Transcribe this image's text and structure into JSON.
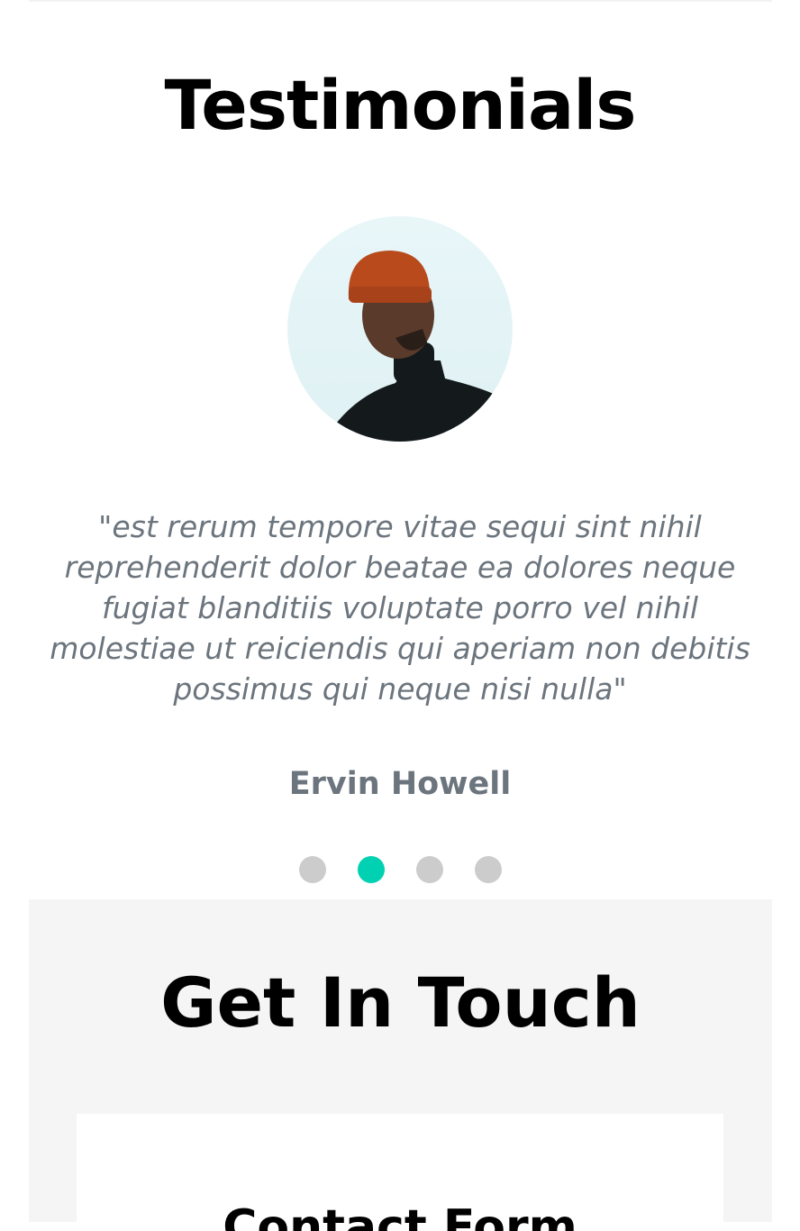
{
  "testimonials": {
    "title": "Testimonials",
    "quote": "\"est rerum tempore vitae sequi sint nihil reprehenderit dolor beatae ea dolores neque fugiat blanditiis voluptate porro vel nihil molestiae ut reiciendis qui aperiam non debitis possimus qui neque nisi nulla\"",
    "author": "Ervin Howell",
    "slide_count": 4,
    "active_slide": 2,
    "active_color": "#00d1b2",
    "inactive_color": "#cccccc"
  },
  "contact": {
    "title": "Get In Touch",
    "form_title": "Contact Form",
    "background": "#f5f5f5"
  }
}
